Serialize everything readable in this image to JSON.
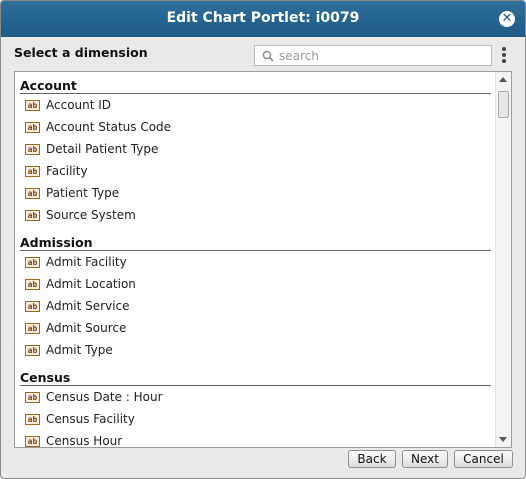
{
  "dialog": {
    "title": "Edit Chart Portlet: i0079",
    "close_icon": "close-icon"
  },
  "heading": "Select a dimension",
  "search": {
    "placeholder": "search",
    "value": ""
  },
  "groups": [
    {
      "label": "Account",
      "items": [
        "Account ID",
        "Account Status Code",
        "Detail Patient Type",
        "Facility",
        "Patient Type",
        "Source System"
      ]
    },
    {
      "label": "Admission",
      "items": [
        "Admit Facility",
        "Admit Location",
        "Admit Service",
        "Admit Source",
        "Admit Type"
      ]
    },
    {
      "label": "Census",
      "items": [
        "Census Date : Hour",
        "Census Facility",
        "Census Hour"
      ]
    }
  ],
  "item_icon_text": "ab",
  "buttons": {
    "back": "Back",
    "next": "Next",
    "cancel": "Cancel"
  }
}
